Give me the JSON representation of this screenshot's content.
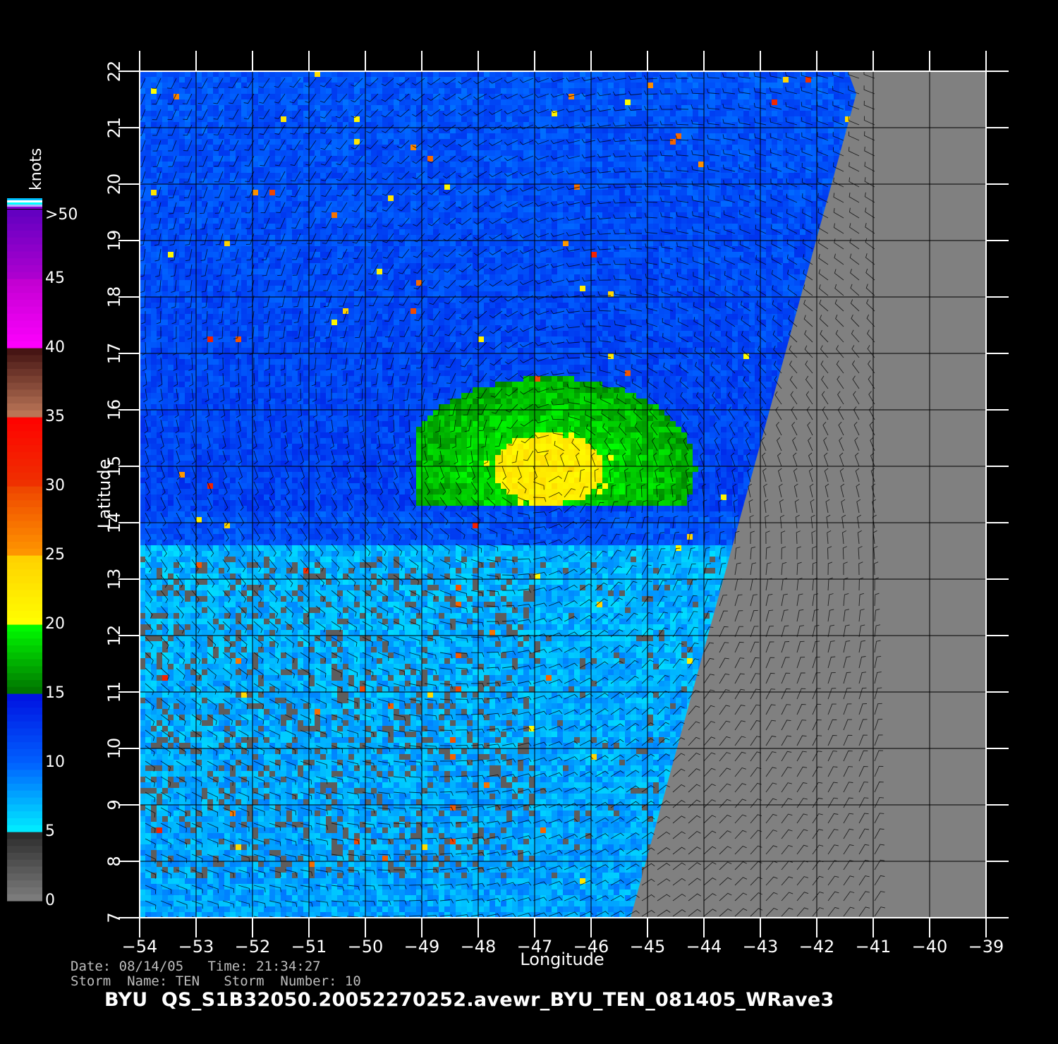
{
  "map": {
    "lon_range": [
      -54,
      -39
    ],
    "lat_range": [
      7,
      22
    ],
    "lon_ticks": [
      -54,
      -53,
      -52,
      -51,
      -50,
      -49,
      -48,
      -47,
      -46,
      -45,
      -44,
      -43,
      -42,
      -41,
      -40,
      -39
    ],
    "lat_ticks": [
      7,
      8,
      9,
      10,
      11,
      12,
      13,
      14,
      15,
      16,
      17,
      18,
      19,
      20,
      21,
      22
    ],
    "xlabel": "Longitude",
    "ylabel": "Latitude",
    "no_data_color": "#808080",
    "swath_edge": [
      [
        -41.3,
        21.6
      ],
      [
        -45.3,
        7.0
      ]
    ],
    "wind_field": {
      "background_levels_knots": [
        {
          "region": "north",
          "speed": 12
        },
        {
          "region": "storm-core",
          "speed": 22
        },
        {
          "region": "storm-ring",
          "speed": 17
        },
        {
          "region": "south",
          "speed": 7
        },
        {
          "region": "calm-patches",
          "speed": 2
        }
      ],
      "storm_center": {
        "lon": -46.8,
        "lat": 15.0
      }
    }
  },
  "colorbar": {
    "unit": "knots",
    "tick_labels": [
      ">50",
      "45",
      "40",
      "35",
      "30",
      "25",
      "20",
      "15",
      "10",
      "5",
      "0"
    ],
    "bands": [
      {
        "from": 0,
        "to": 5,
        "color_low": "#7f7f7f",
        "color_high": "#2a2a2a"
      },
      {
        "from": 5,
        "to": 10,
        "color_low": "#00f0ff",
        "color_high": "#0060ff"
      },
      {
        "from": 10,
        "to": 15,
        "color_low": "#0060ff",
        "color_high": "#0010e0"
      },
      {
        "from": 15,
        "to": 20,
        "color_low": "#007000",
        "color_high": "#00ff00"
      },
      {
        "from": 20,
        "to": 25,
        "color_low": "#ffff00",
        "color_high": "#ffd000"
      },
      {
        "from": 25,
        "to": 30,
        "color_low": "#ff9900",
        "color_high": "#ee4400"
      },
      {
        "from": 30,
        "to": 35,
        "color_low": "#ee3300",
        "color_high": "#ff0000"
      },
      {
        "from": 35,
        "to": 40,
        "color_low": "#c07a5a",
        "color_high": "#401010"
      },
      {
        "from": 40,
        "to": 45,
        "color_low": "#ff00ff",
        "color_high": "#c000d0"
      },
      {
        "from": 45,
        "to": 50,
        "color_low": "#b000d0",
        "color_high": "#6000c0"
      }
    ]
  },
  "meta": {
    "date_line": "Date: 08/14/05   Time: 21:34:27",
    "storm_line": "Storm  Name: TEN   Storm  Number: 10",
    "filename": "BYU  QS_S1B32050.20052270252.avewr_BYU_TEN_081405_WRave3"
  }
}
